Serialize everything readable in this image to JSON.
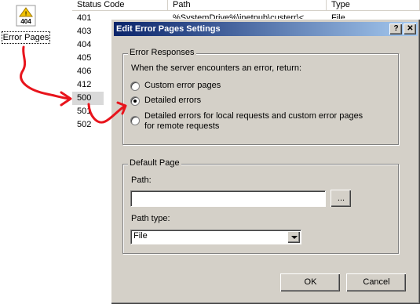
{
  "desktop_icon": {
    "badge": "404",
    "label": "Error Pages"
  },
  "list": {
    "columns": [
      "Status Code",
      "Path",
      "Type"
    ],
    "first_row": {
      "path": "%SystemDrive%\\inetpub\\custerr\\<",
      "type": "File"
    },
    "status_codes": [
      "401",
      "403",
      "404",
      "405",
      "406",
      "412",
      "500",
      "501",
      "502"
    ],
    "selected": "500"
  },
  "dialog": {
    "title": "Edit Error Pages Settings",
    "help_button": "?",
    "close_button": "✕",
    "error_responses": {
      "legend": "Error Responses",
      "prompt": "When the server encounters an error, return:",
      "options": [
        {
          "label": "Custom error pages",
          "checked": false
        },
        {
          "label": "Detailed errors",
          "checked": true
        },
        {
          "label": "Detailed errors for local requests and custom error pages",
          "label2": "for remote requests",
          "checked": false
        }
      ]
    },
    "default_page": {
      "legend": "Default Page",
      "path_label": "Path:",
      "path_value": "",
      "browse_button": "...",
      "path_type_label": "Path type:",
      "path_type_value": "File"
    },
    "ok_button": "OK",
    "cancel_button": "Cancel"
  },
  "colors": {
    "annotation_red": "#e8141c",
    "title_blue": "#0a246a",
    "dialog_face": "#d4d0c8"
  }
}
